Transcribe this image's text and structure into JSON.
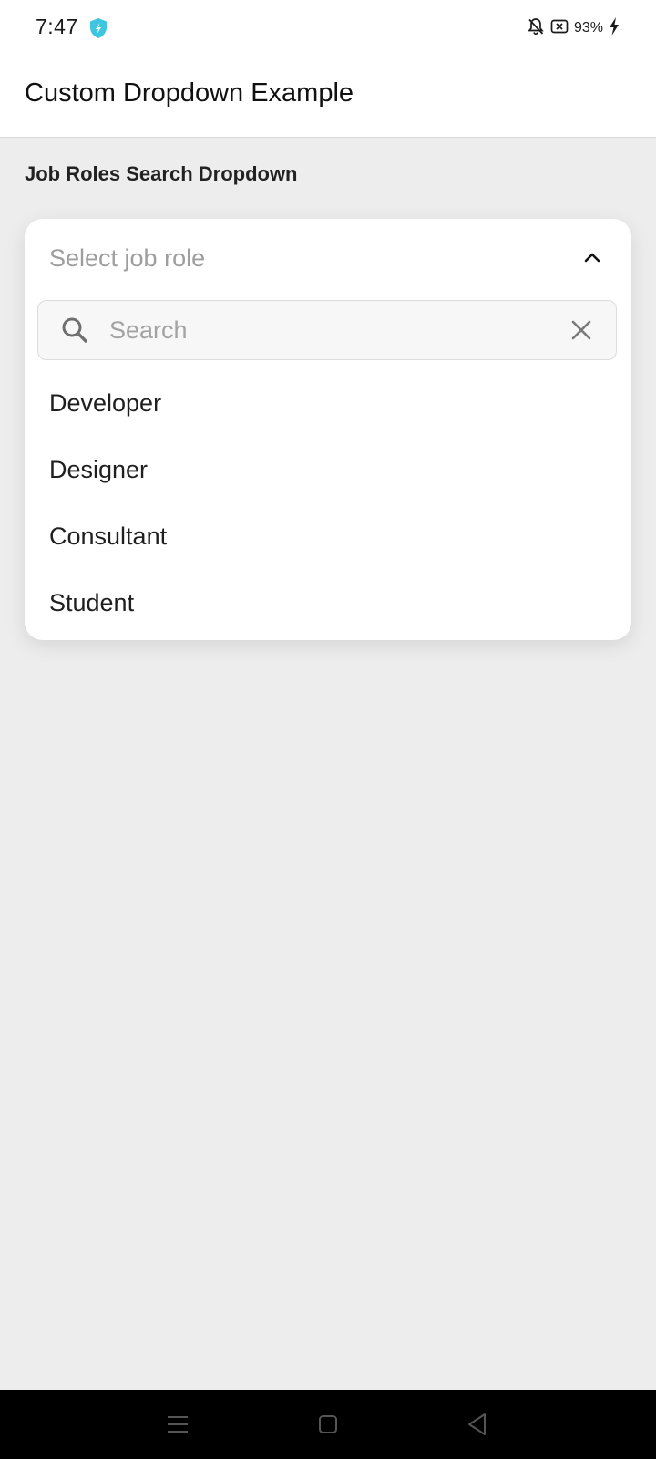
{
  "status_bar": {
    "time": "7:47",
    "battery_percent": "93%",
    "icons": [
      "shield-bolt-icon",
      "bell-off-icon",
      "battery-saver-icon",
      "charging-bolt-icon"
    ]
  },
  "app_bar": {
    "title": "Custom Dropdown Example"
  },
  "section": {
    "label": "Job Roles Search Dropdown"
  },
  "dropdown": {
    "placeholder": "Select job role",
    "expanded": true,
    "search": {
      "placeholder": "Search",
      "value": ""
    },
    "options": [
      {
        "label": "Developer"
      },
      {
        "label": "Designer"
      },
      {
        "label": "Consultant"
      },
      {
        "label": "Student"
      }
    ]
  },
  "nav_bar": {
    "buttons": [
      "menu-icon",
      "home-icon",
      "back-icon"
    ]
  },
  "colors": {
    "page_background": "#ededed",
    "surface": "#ffffff",
    "placeholder_text": "#9e9e9e",
    "shield_accent": "#3ec6e0"
  }
}
